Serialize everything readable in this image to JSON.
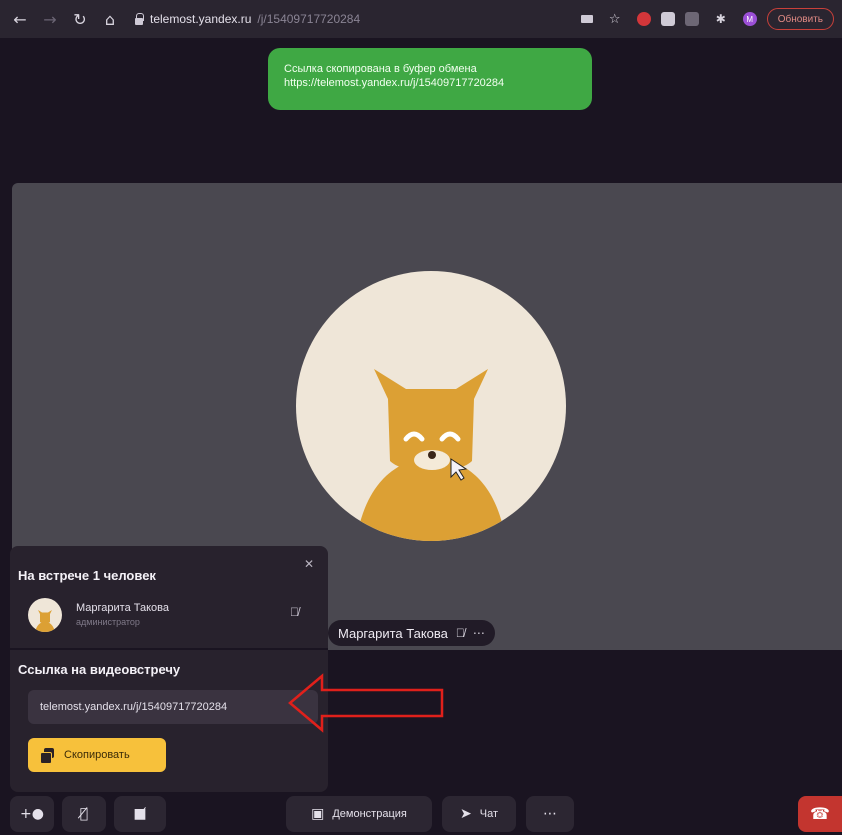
{
  "browser": {
    "url_host": "telemost.yandex.ru",
    "url_path": "/j/15409717720284",
    "update_label": "Обновить",
    "profile_initials": "M"
  },
  "toast": {
    "line1": "Ссылка скопирована в буфер обмена",
    "line2": "https://telemost.yandex.ru/j/15409717720284"
  },
  "video": {
    "participant_name": "Маргарита Такова"
  },
  "panel": {
    "title": "На встрече 1 человек",
    "participant_name": "Маргарита Такова",
    "participant_role": "администратор",
    "link_title": "Ссылка на видеовстречу",
    "link_value": "telemost.yandex.ru/j/15409717720284",
    "copy_label": "Скопировать"
  },
  "toolbar": {
    "demo_label": "Демонстрация",
    "chat_label": "Чат"
  },
  "colors": {
    "toast": "#3fa844",
    "accent_button": "#f7c13b",
    "hangup": "#c3352f",
    "annotation_arrow": "#e0201b",
    "cat": "#dca034"
  }
}
